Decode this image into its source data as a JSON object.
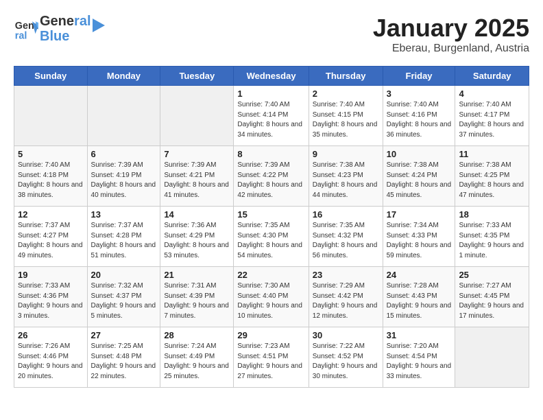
{
  "header": {
    "logo_line1": "General",
    "logo_line2": "Blue",
    "month": "January 2025",
    "location": "Eberau, Burgenland, Austria"
  },
  "weekdays": [
    "Sunday",
    "Monday",
    "Tuesday",
    "Wednesday",
    "Thursday",
    "Friday",
    "Saturday"
  ],
  "weeks": [
    [
      {
        "day": "",
        "info": ""
      },
      {
        "day": "",
        "info": ""
      },
      {
        "day": "",
        "info": ""
      },
      {
        "day": "1",
        "info": "Sunrise: 7:40 AM\nSunset: 4:14 PM\nDaylight: 8 hours and 34 minutes."
      },
      {
        "day": "2",
        "info": "Sunrise: 7:40 AM\nSunset: 4:15 PM\nDaylight: 8 hours and 35 minutes."
      },
      {
        "day": "3",
        "info": "Sunrise: 7:40 AM\nSunset: 4:16 PM\nDaylight: 8 hours and 36 minutes."
      },
      {
        "day": "4",
        "info": "Sunrise: 7:40 AM\nSunset: 4:17 PM\nDaylight: 8 hours and 37 minutes."
      }
    ],
    [
      {
        "day": "5",
        "info": "Sunrise: 7:40 AM\nSunset: 4:18 PM\nDaylight: 8 hours and 38 minutes."
      },
      {
        "day": "6",
        "info": "Sunrise: 7:39 AM\nSunset: 4:19 PM\nDaylight: 8 hours and 40 minutes."
      },
      {
        "day": "7",
        "info": "Sunrise: 7:39 AM\nSunset: 4:21 PM\nDaylight: 8 hours and 41 minutes."
      },
      {
        "day": "8",
        "info": "Sunrise: 7:39 AM\nSunset: 4:22 PM\nDaylight: 8 hours and 42 minutes."
      },
      {
        "day": "9",
        "info": "Sunrise: 7:38 AM\nSunset: 4:23 PM\nDaylight: 8 hours and 44 minutes."
      },
      {
        "day": "10",
        "info": "Sunrise: 7:38 AM\nSunset: 4:24 PM\nDaylight: 8 hours and 45 minutes."
      },
      {
        "day": "11",
        "info": "Sunrise: 7:38 AM\nSunset: 4:25 PM\nDaylight: 8 hours and 47 minutes."
      }
    ],
    [
      {
        "day": "12",
        "info": "Sunrise: 7:37 AM\nSunset: 4:27 PM\nDaylight: 8 hours and 49 minutes."
      },
      {
        "day": "13",
        "info": "Sunrise: 7:37 AM\nSunset: 4:28 PM\nDaylight: 8 hours and 51 minutes."
      },
      {
        "day": "14",
        "info": "Sunrise: 7:36 AM\nSunset: 4:29 PM\nDaylight: 8 hours and 53 minutes."
      },
      {
        "day": "15",
        "info": "Sunrise: 7:35 AM\nSunset: 4:30 PM\nDaylight: 8 hours and 54 minutes."
      },
      {
        "day": "16",
        "info": "Sunrise: 7:35 AM\nSunset: 4:32 PM\nDaylight: 8 hours and 56 minutes."
      },
      {
        "day": "17",
        "info": "Sunrise: 7:34 AM\nSunset: 4:33 PM\nDaylight: 8 hours and 59 minutes."
      },
      {
        "day": "18",
        "info": "Sunrise: 7:33 AM\nSunset: 4:35 PM\nDaylight: 9 hours and 1 minute."
      }
    ],
    [
      {
        "day": "19",
        "info": "Sunrise: 7:33 AM\nSunset: 4:36 PM\nDaylight: 9 hours and 3 minutes."
      },
      {
        "day": "20",
        "info": "Sunrise: 7:32 AM\nSunset: 4:37 PM\nDaylight: 9 hours and 5 minutes."
      },
      {
        "day": "21",
        "info": "Sunrise: 7:31 AM\nSunset: 4:39 PM\nDaylight: 9 hours and 7 minutes."
      },
      {
        "day": "22",
        "info": "Sunrise: 7:30 AM\nSunset: 4:40 PM\nDaylight: 9 hours and 10 minutes."
      },
      {
        "day": "23",
        "info": "Sunrise: 7:29 AM\nSunset: 4:42 PM\nDaylight: 9 hours and 12 minutes."
      },
      {
        "day": "24",
        "info": "Sunrise: 7:28 AM\nSunset: 4:43 PM\nDaylight: 9 hours and 15 minutes."
      },
      {
        "day": "25",
        "info": "Sunrise: 7:27 AM\nSunset: 4:45 PM\nDaylight: 9 hours and 17 minutes."
      }
    ],
    [
      {
        "day": "26",
        "info": "Sunrise: 7:26 AM\nSunset: 4:46 PM\nDaylight: 9 hours and 20 minutes."
      },
      {
        "day": "27",
        "info": "Sunrise: 7:25 AM\nSunset: 4:48 PM\nDaylight: 9 hours and 22 minutes."
      },
      {
        "day": "28",
        "info": "Sunrise: 7:24 AM\nSunset: 4:49 PM\nDaylight: 9 hours and 25 minutes."
      },
      {
        "day": "29",
        "info": "Sunrise: 7:23 AM\nSunset: 4:51 PM\nDaylight: 9 hours and 27 minutes."
      },
      {
        "day": "30",
        "info": "Sunrise: 7:22 AM\nSunset: 4:52 PM\nDaylight: 9 hours and 30 minutes."
      },
      {
        "day": "31",
        "info": "Sunrise: 7:20 AM\nSunset: 4:54 PM\nDaylight: 9 hours and 33 minutes."
      },
      {
        "day": "",
        "info": ""
      }
    ]
  ]
}
